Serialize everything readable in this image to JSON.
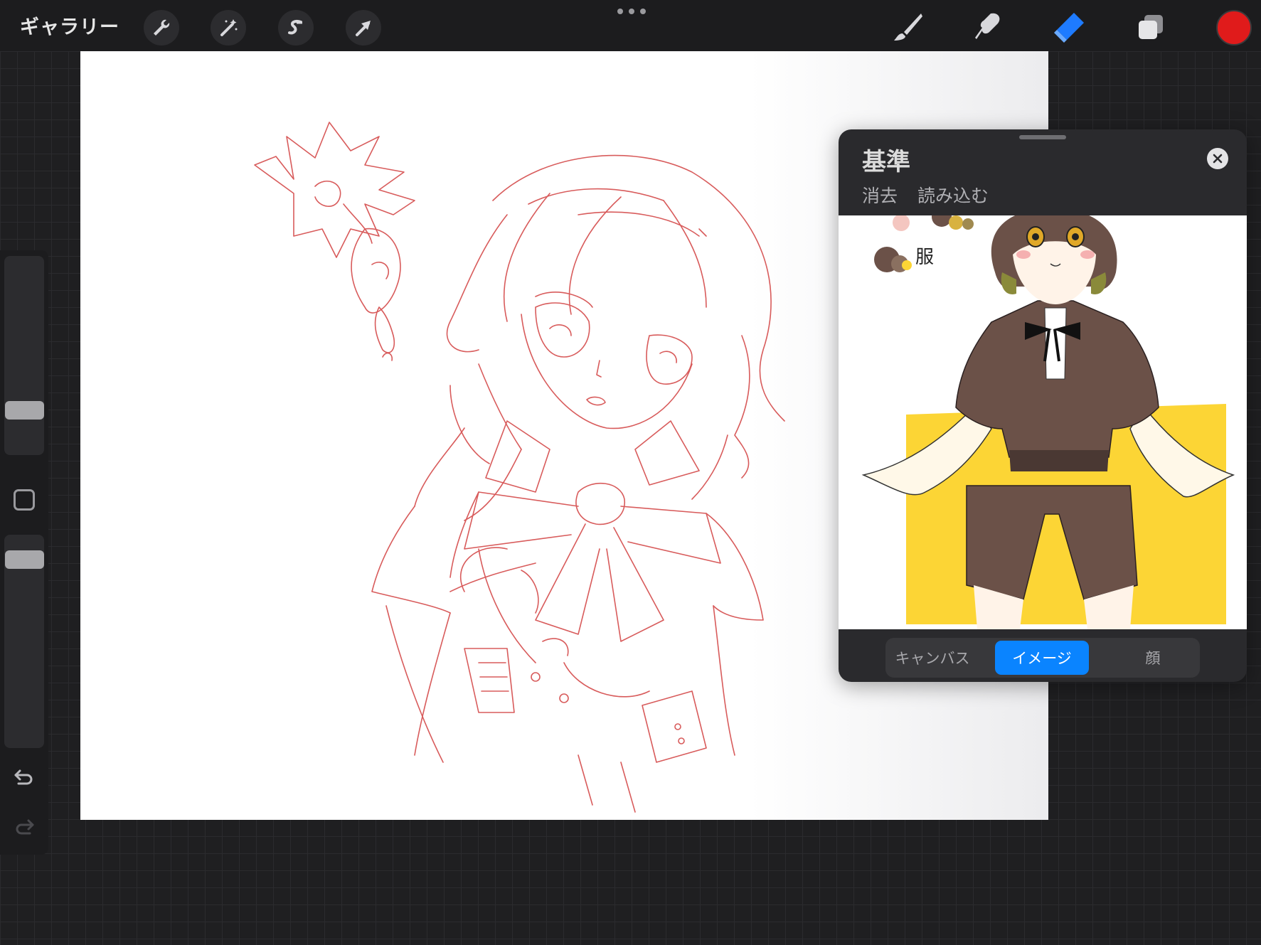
{
  "topbar": {
    "gallery_label": "ギャラリー",
    "tools": [
      "wrench-icon",
      "magic-wand-icon",
      "selection-icon",
      "transform-arrow-icon"
    ],
    "right_tools": [
      "brush-icon",
      "smudge-icon",
      "eraser-icon",
      "layers-icon"
    ],
    "current_color": "#e01b1b",
    "accent": "#1e7bff"
  },
  "panel": {
    "title": "基準",
    "actions": {
      "clear": "消去",
      "import": "読み込む"
    },
    "reference_note": "服",
    "tabs": [
      {
        "label": "キャンバス",
        "active": false
      },
      {
        "label": "イメージ",
        "active": true
      },
      {
        "label": "顔",
        "active": false
      }
    ]
  },
  "sidebar": {
    "brush_size_level": 0.05,
    "opacity_level": 0.85
  },
  "colors": {
    "sketch_line": "#d44a4a",
    "ref_yellow": "#fcd535",
    "ref_brown": "#6b5148",
    "tab_active": "#0a84ff"
  }
}
